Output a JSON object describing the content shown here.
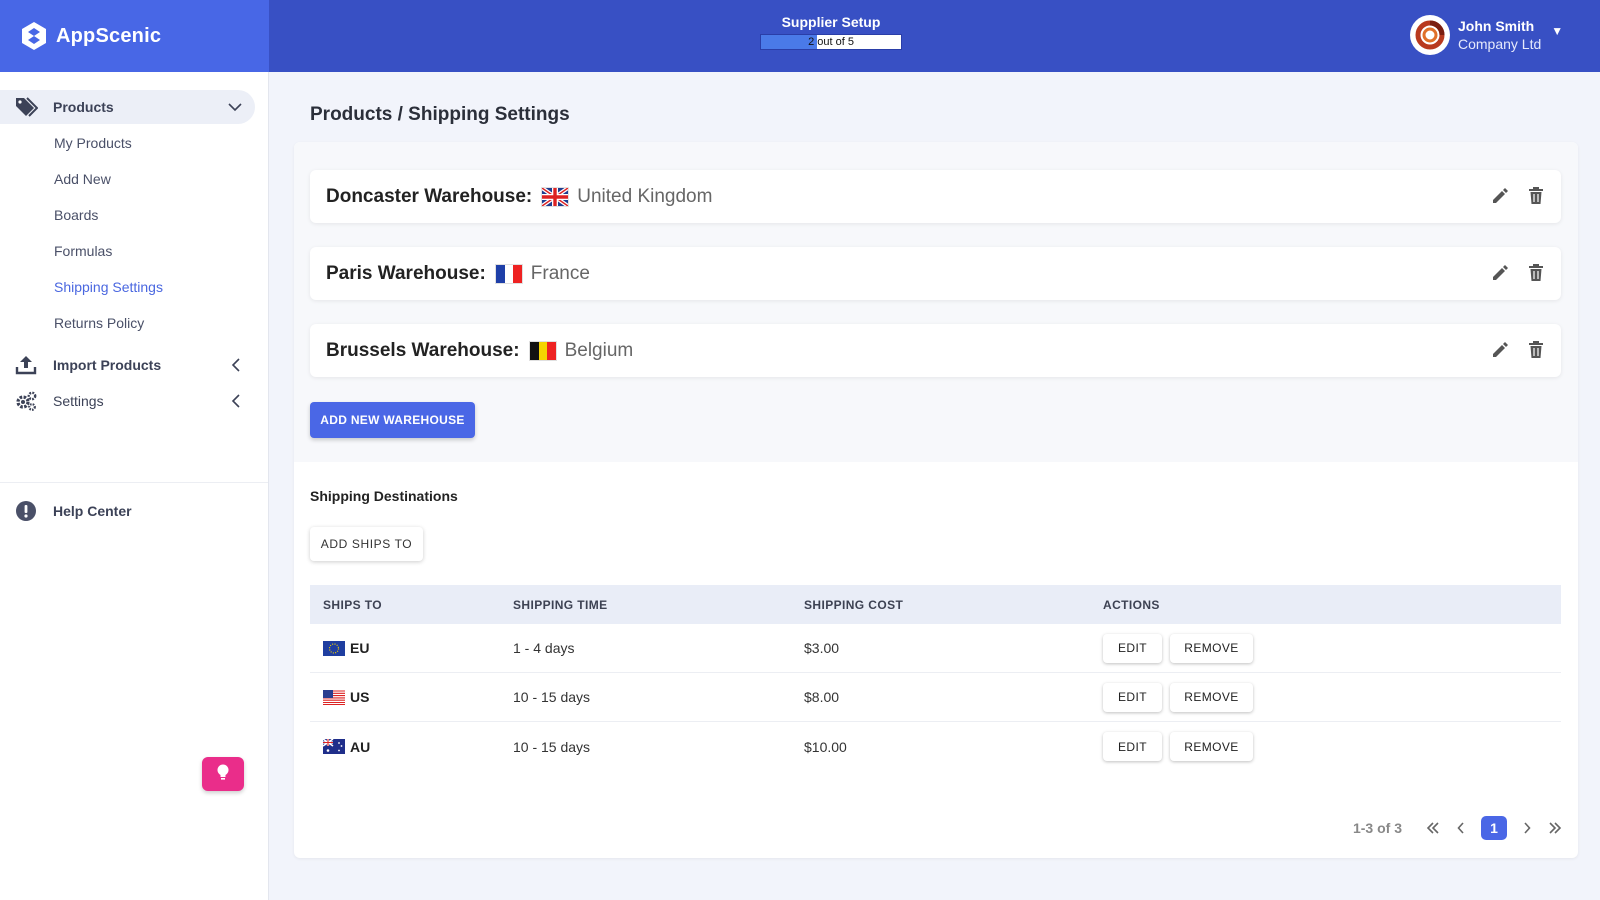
{
  "header": {
    "brand": "AppScenic",
    "setup": {
      "title": "Supplier Setup",
      "progress_text": "2 out of 5",
      "progress_fraction": 0.4
    },
    "user": {
      "name": "John Smith",
      "company": "Company Ltd"
    }
  },
  "sidebar": {
    "products": {
      "label": "Products",
      "items": [
        {
          "label": "My Products"
        },
        {
          "label": "Add New"
        },
        {
          "label": "Boards"
        },
        {
          "label": "Formulas"
        },
        {
          "label": "Shipping Settings",
          "active": true
        },
        {
          "label": "Returns Policy"
        }
      ]
    },
    "import_products": {
      "label": "Import Products"
    },
    "settings": {
      "label": "Settings"
    },
    "help_center": {
      "label": "Help Center"
    }
  },
  "page": {
    "title": "Products / Shipping Settings",
    "warehouses": [
      {
        "name": "Doncaster Warehouse:",
        "country": "United Kingdom",
        "flag": "uk-flag"
      },
      {
        "name": "Paris Warehouse:",
        "country": "France",
        "flag": "france-flag"
      },
      {
        "name": "Brussels Warehouse:",
        "country": "Belgium",
        "flag": "belgium-flag"
      }
    ],
    "add_warehouse_label": "ADD NEW WAREHOUSE",
    "shipping": {
      "title": "Shipping Destinations",
      "add_label": "ADD SHIPS TO",
      "columns": [
        "SHIPS TO",
        "SHIPPING TIME",
        "SHIPPING COST",
        "ACTIONS"
      ],
      "rows": [
        {
          "ships_to": "EU",
          "time": "1 - 4 days",
          "cost": "$3.00",
          "flag": "eu-flag"
        },
        {
          "ships_to": "US",
          "time": "10 - 15 days",
          "cost": "$8.00",
          "flag": "us-flag"
        },
        {
          "ships_to": "AU",
          "time": "10 - 15 days",
          "cost": "$10.00",
          "flag": "au-flag"
        }
      ],
      "edit_label": "EDIT",
      "remove_label": "REMOVE",
      "pagination": {
        "range": "1-3 of 3",
        "current_page": "1"
      }
    }
  },
  "colors": {
    "topbar": "#3850c4",
    "brand": "#4867e6",
    "accent": "#4a67e6",
    "help_fab": "#ea2d8a"
  }
}
